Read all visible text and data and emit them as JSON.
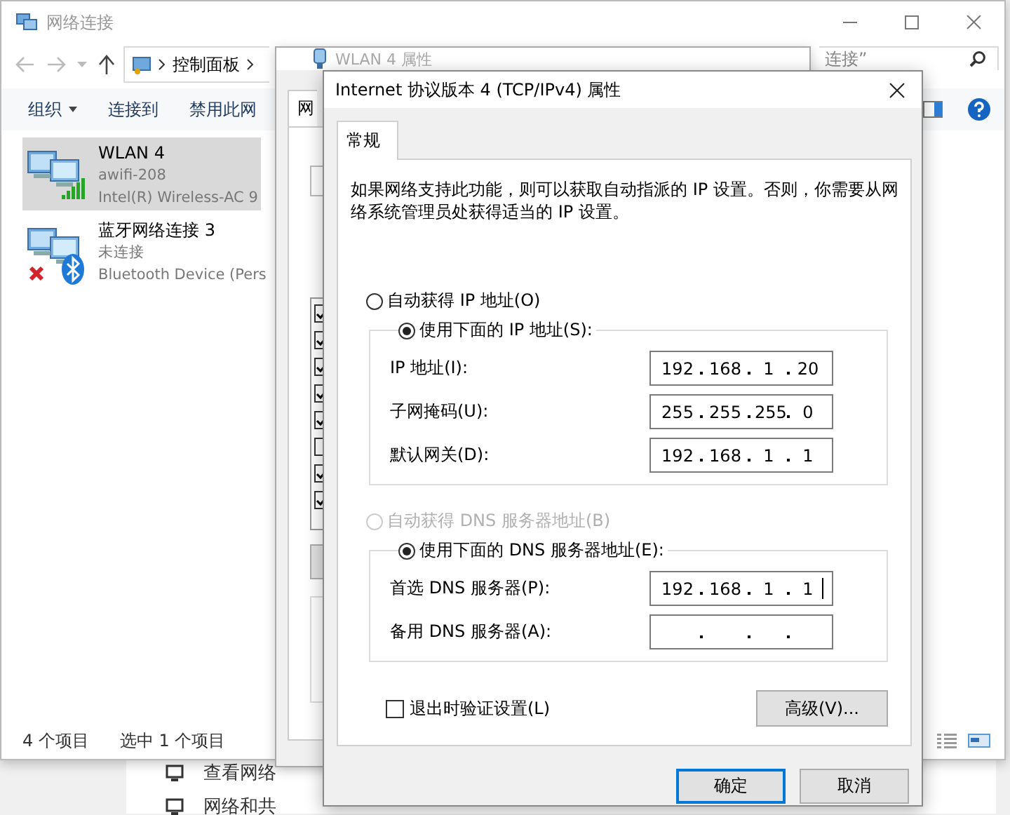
{
  "desktop_window": {
    "items": [
      {
        "label": "查看网络"
      },
      {
        "label": "网络和共"
      }
    ]
  },
  "explorer": {
    "title": "网络连接",
    "path": [
      "控制面板"
    ],
    "search": {
      "placeholder": "连接”"
    },
    "toolbar": [
      {
        "label": "组织",
        "kind": "menu"
      },
      {
        "label": "连接到",
        "kind": "command"
      },
      {
        "label": "禁用此网",
        "kind": "command"
      }
    ],
    "items": [
      {
        "name": "WLAN 4",
        "status": "awifi-208",
        "device": "Intel(R) Wireless-AC 9",
        "kind": "wifi",
        "selected": true
      },
      {
        "name": "蓝牙网络连接 3",
        "status": "未连接",
        "device": "Bluetooth Device (Pers",
        "kind": "bluetooth",
        "selected": false
      }
    ],
    "status_bar": {
      "count": "4 个项目",
      "selection": "选中 1 个项目"
    }
  },
  "wlan_properties": {
    "title": "WLAN 4 属性",
    "tab": "网",
    "components": [
      {
        "checked": true
      },
      {
        "checked": true
      },
      {
        "checked": true
      },
      {
        "checked": true
      },
      {
        "checked": true
      },
      {
        "checked": false
      },
      {
        "checked": true
      },
      {
        "checked": true
      }
    ]
  },
  "ipv4_properties": {
    "title": "Internet 协议版本 4 (TCP/IPv4) 属性",
    "tabs": [
      {
        "label": "常规",
        "selected": true
      }
    ],
    "description": "如果网络支持此功能，则可以获取自动指派的 IP 设置。否则，你需要从网络系统管理员处获得适当的 IP 设置。",
    "ip_mode": [
      {
        "label": "自动获得 IP 地址(O)",
        "selected": false,
        "disabled": false
      },
      {
        "label": "使用下面的 IP 地址(S):",
        "selected": true,
        "disabled": false
      }
    ],
    "ip_fields": [
      {
        "label": "IP 地址(I):",
        "octets": [
          "192",
          "168",
          "1",
          "20"
        ],
        "focused": false
      },
      {
        "label": "子网掩码(U):",
        "octets": [
          "255",
          "255",
          "255",
          "0"
        ],
        "focused": false
      },
      {
        "label": "默认网关(D):",
        "octets": [
          "192",
          "168",
          "1",
          "1"
        ],
        "focused": false
      }
    ],
    "dns_mode": [
      {
        "label": "自动获得 DNS 服务器地址(B)",
        "selected": false,
        "disabled": true
      },
      {
        "label": "使用下面的 DNS 服务器地址(E):",
        "selected": true,
        "disabled": false
      }
    ],
    "dns_fields": [
      {
        "label": "首选 DNS 服务器(P):",
        "octets": [
          "192",
          "168",
          "1",
          "1"
        ],
        "focused": true
      },
      {
        "label": "备用 DNS 服务器(A):",
        "focused": false
      }
    ],
    "validate_on_exit": {
      "label": "退出时验证设置(L)",
      "checked": false
    },
    "advanced_button": "高级(V)...",
    "buttons": [
      {
        "label": "确定",
        "default": true
      },
      {
        "label": "取消",
        "default": false
      }
    ]
  }
}
